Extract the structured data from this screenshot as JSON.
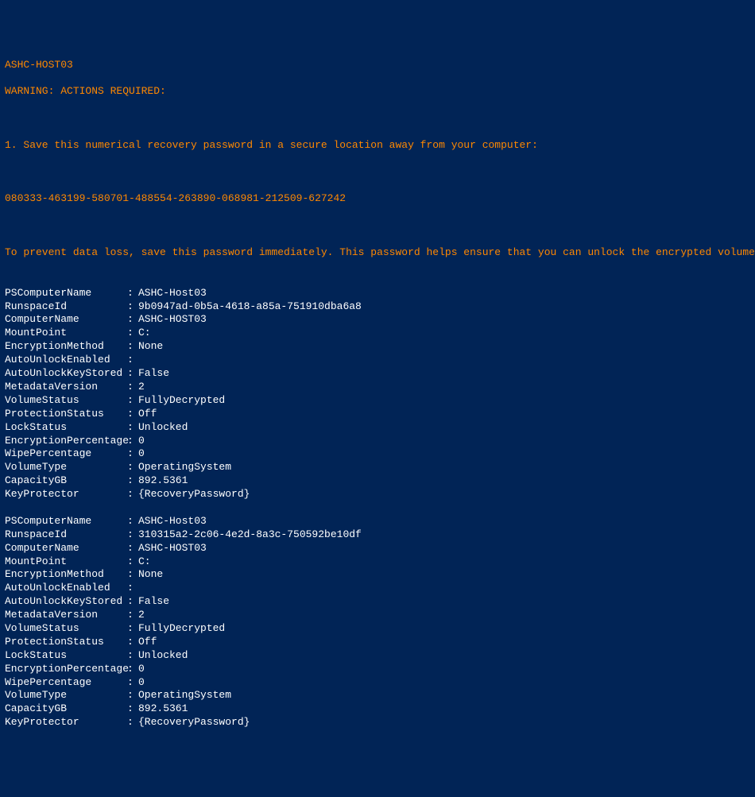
{
  "header": {
    "hostname": "ASHC-HOST03",
    "warning_label": "WARNING: ACTIONS REQUIRED:",
    "instruction_line": "1. Save this numerical recovery password in a secure location away from your computer:",
    "recovery_password": "080333-463199-580701-488554-263890-068981-212509-627242",
    "save_notice": "To prevent data loss, save this password immediately. This password helps ensure that you can unlock the encrypted volume."
  },
  "blocks": [
    {
      "PSComputerName": "ASHC-Host03",
      "RunspaceId": "9b0947ad-0b5a-4618-a85a-751910dba6a8",
      "ComputerName": "ASHC-HOST03",
      "MountPoint": "C:",
      "EncryptionMethod": "None",
      "AutoUnlockEnabled": "",
      "AutoUnlockKeyStored": "False",
      "MetadataVersion": "2",
      "VolumeStatus": "FullyDecrypted",
      "ProtectionStatus": "Off",
      "LockStatus": "Unlocked",
      "EncryptionPercentage": "0",
      "WipePercentage": "0",
      "VolumeType": "OperatingSystem",
      "CapacityGB": "892.5361",
      "KeyProtector": "{RecoveryPassword}"
    },
    {
      "PSComputerName": "ASHC-Host03",
      "RunspaceId": "310315a2-2c06-4e2d-8a3c-750592be10df",
      "ComputerName": "ASHC-HOST03",
      "MountPoint": "C:",
      "EncryptionMethod": "None",
      "AutoUnlockEnabled": "",
      "AutoUnlockKeyStored": "False",
      "MetadataVersion": "2",
      "VolumeStatus": "FullyDecrypted",
      "ProtectionStatus": "Off",
      "LockStatus": "Unlocked",
      "EncryptionPercentage": "0",
      "WipePercentage": "0",
      "VolumeType": "OperatingSystem",
      "CapacityGB": "892.5361",
      "KeyProtector": "{RecoveryPassword}"
    }
  ],
  "prop_order": [
    "PSComputerName",
    "RunspaceId",
    "ComputerName",
    "MountPoint",
    "EncryptionMethod",
    "AutoUnlockEnabled",
    "AutoUnlockKeyStored",
    "MetadataVersion",
    "VolumeStatus",
    "ProtectionStatus",
    "LockStatus",
    "EncryptionPercentage",
    "WipePercentage",
    "VolumeType",
    "CapacityGB",
    "KeyProtector"
  ]
}
